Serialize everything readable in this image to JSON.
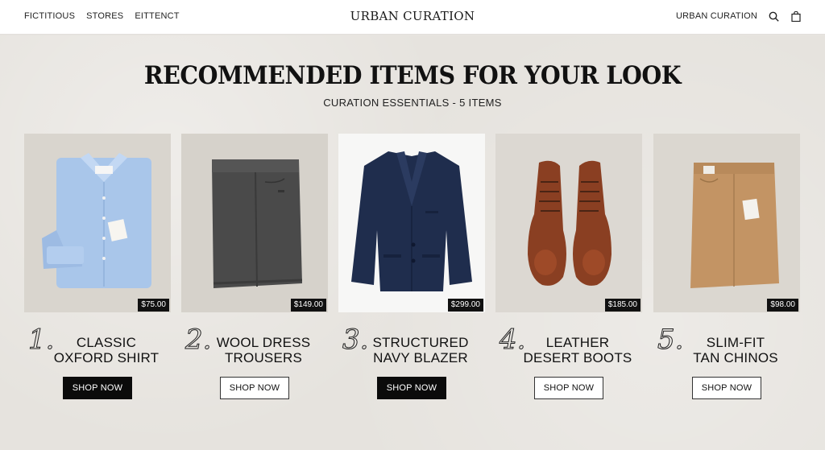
{
  "header": {
    "nav_left": [
      "FICTITIOUS",
      "STORES",
      "EITTENCT"
    ],
    "brand": "URBAN CURATION",
    "account_label": "URBAN CURATION",
    "icons": [
      "search-icon",
      "shopping-bag-icon"
    ]
  },
  "main": {
    "title": "RECOMMENDED ITEMS FOR YOUR LOOK",
    "subtitle": "CURATION ESSENTIALS - 5 ITEMS"
  },
  "products": [
    {
      "number": "1.",
      "name_line1": "CLASSIC",
      "name_line2": "OXFORD SHIRT",
      "price": "$75.00",
      "button": "SHOP NOW",
      "button_style": "dark"
    },
    {
      "number": "2.",
      "name_line1": "WOOL DRESS",
      "name_line2": "TROUSERS",
      "price": "$149.00",
      "button": "SHOP NOW",
      "button_style": "light"
    },
    {
      "number": "3.",
      "name_line1": "STRUCTURED",
      "name_line2": "NAVY BLAZER",
      "price": "$299.00",
      "button": "SHOP NOW",
      "button_style": "dark"
    },
    {
      "number": "4.",
      "name_line1": "LEATHER",
      "name_line2": "DESERT BOOTS",
      "price": "$185.00",
      "button": "SHOP NOW",
      "button_style": "light"
    },
    {
      "number": "5.",
      "name_line1": "SLIM-FIT",
      "name_line2": "TAN CHINOS",
      "price": "$98.00",
      "button": "SHOP NOW",
      "button_style": "light"
    }
  ],
  "colors": {
    "background": "#e6e3de",
    "header_bg": "#ffffff",
    "button_dark": "#0b0b0b",
    "shirt": "#a9c6ea",
    "trousers": "#4a4a4a",
    "blazer": "#1f2d4d",
    "boots": "#8a3f22",
    "chinos": "#c39464"
  }
}
